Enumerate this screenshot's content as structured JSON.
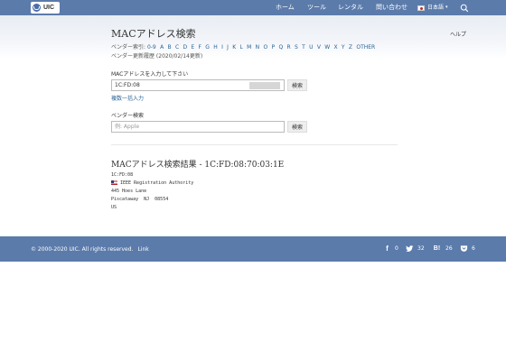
{
  "nav": {
    "logo_text": "UIC",
    "items": [
      {
        "label": "ホーム"
      },
      {
        "label": "ツール"
      },
      {
        "label": "レンタル"
      },
      {
        "label": "問い合わせ"
      }
    ],
    "language": "日本語",
    "caret": "▾"
  },
  "page": {
    "title": "MACアドレス検索",
    "help": "ヘルプ"
  },
  "vendor_index": {
    "label": "ベンダー索引:",
    "letters": [
      "0-9",
      "A",
      "B",
      "C",
      "D",
      "E",
      "F",
      "G",
      "H",
      "I",
      "J",
      "K",
      "L",
      "M",
      "N",
      "O",
      "P",
      "Q",
      "R",
      "S",
      "T",
      "U",
      "V",
      "W",
      "X",
      "Y",
      "Z",
      "OTHER"
    ],
    "update_text": "ベンダー更新履歴 (2020/02/14更新)"
  },
  "mac_search": {
    "label": "MACアドレスを入力して下さい",
    "value": "1C:FD:08",
    "button": "検索",
    "bulk_link": "複数一括入力"
  },
  "vendor_search": {
    "label": "ベンダー検索",
    "placeholder": "例: Apple",
    "button": "検索"
  },
  "result": {
    "title": "MACアドレス検索結果 - 1C:FD:08:70:03:1E",
    "prefix": "1C:FD:08",
    "organization": "IEEE Registration Authority",
    "address1": "445 Hoes Lane",
    "address2": "Piscataway  NJ  08554",
    "country": "US"
  },
  "footer": {
    "copyright": "© 2000-2020 UIC. All rights reserved.",
    "link": "Link",
    "shares": [
      {
        "icon": "facebook-icon",
        "glyph": "f",
        "count": "0"
      },
      {
        "icon": "twitter-icon",
        "glyph": "",
        "count": "32"
      },
      {
        "icon": "hatena-bookmark-icon",
        "glyph": "B!",
        "count": "26"
      },
      {
        "icon": "pocket-icon",
        "glyph": "",
        "count": "6"
      }
    ]
  },
  "colors": {
    "nav_bg": "#5b7bab",
    "link": "#2a6496"
  }
}
